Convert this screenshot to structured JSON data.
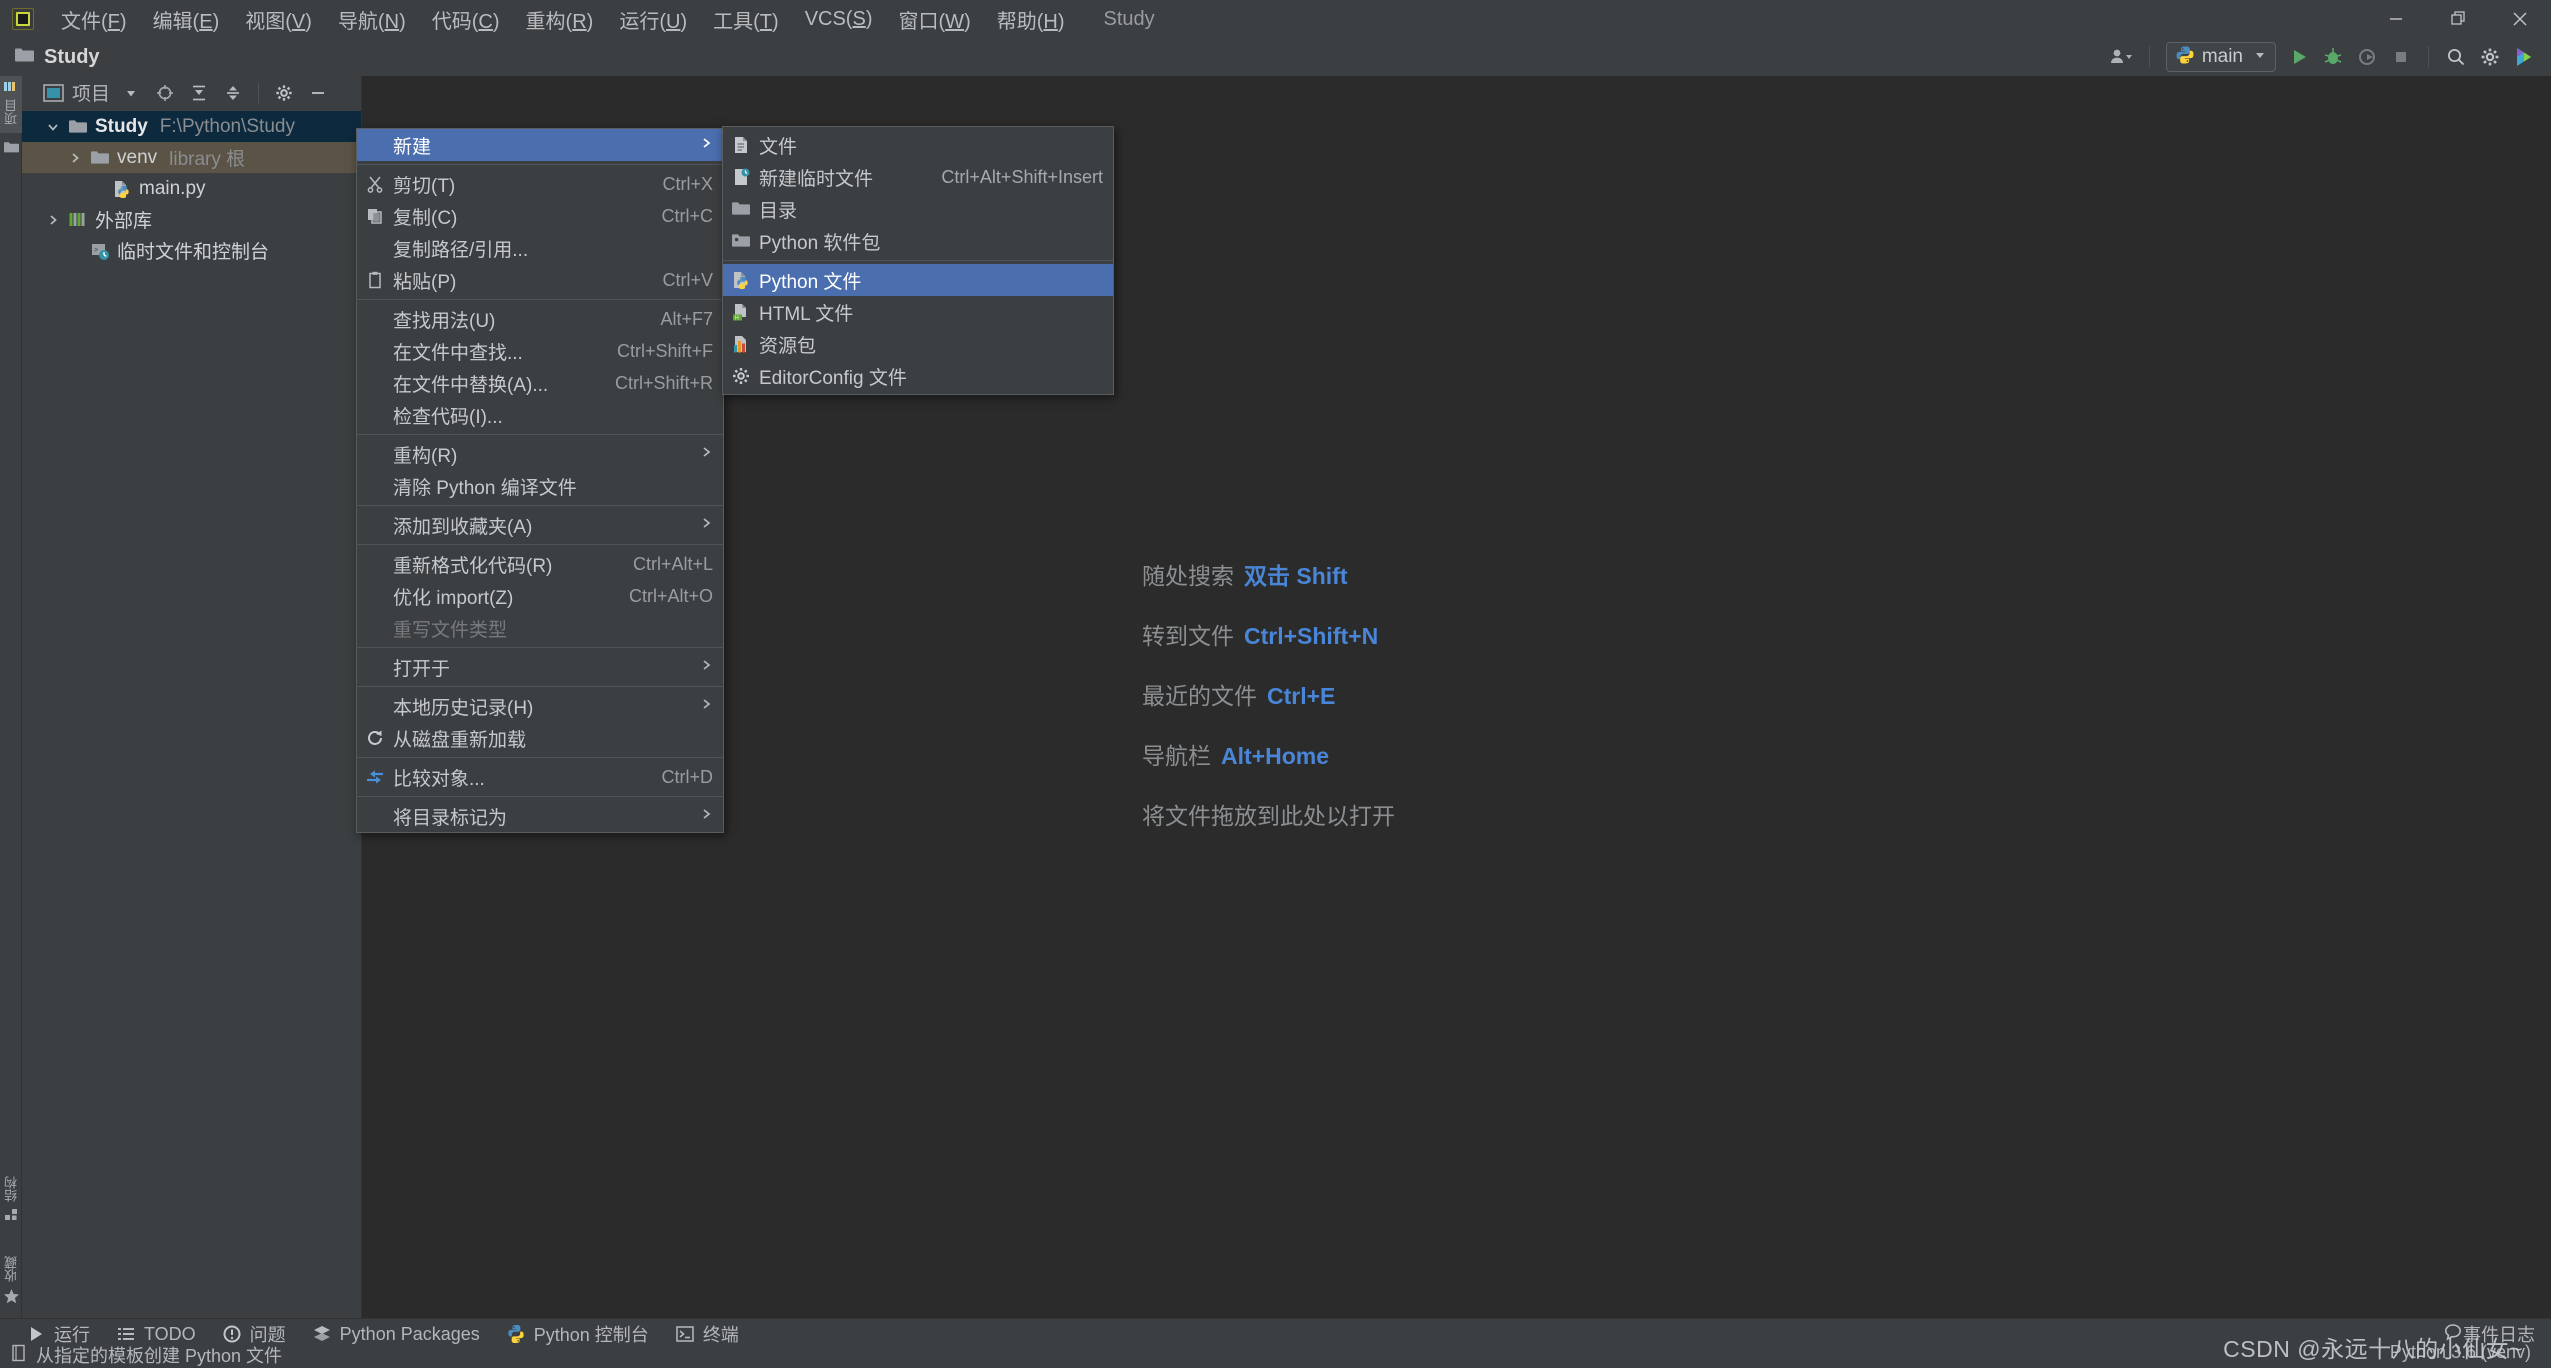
{
  "window": {
    "app_icon": "pycharm-logo-icon",
    "project_name": "Study",
    "menus": [
      {
        "label": "文件(F)",
        "name": "menu-file"
      },
      {
        "label": "编辑(E)",
        "name": "menu-edit"
      },
      {
        "label": "视图(V)",
        "name": "menu-view"
      },
      {
        "label": "导航(N)",
        "name": "menu-navigate"
      },
      {
        "label": "代码(C)",
        "name": "menu-code"
      },
      {
        "label": "重构(R)",
        "name": "menu-refactor"
      },
      {
        "label": "运行(U)",
        "name": "menu-run"
      },
      {
        "label": "工具(T)",
        "name": "menu-tools"
      },
      {
        "label": "VCS(S)",
        "name": "menu-vcs"
      },
      {
        "label": "窗口(W)",
        "name": "menu-window"
      },
      {
        "label": "帮助(H)",
        "name": "menu-help"
      }
    ],
    "controls": {
      "minimize": "–",
      "maximize": "❐",
      "close": "✕"
    }
  },
  "toolbar": {
    "title": "Study",
    "run_config": "main",
    "icons": [
      "account-icon",
      "run-icon",
      "debug-icon",
      "coverage-icon",
      "stop-icon",
      "search-everywhere-icon",
      "settings-icon",
      "ai-assistant-icon"
    ]
  },
  "left_strip": {
    "top_tabs": [
      {
        "label": "项目",
        "name": "vtab-project"
      }
    ],
    "bottom_tabs": [
      {
        "label": "结构",
        "name": "vtab-structure"
      },
      {
        "label": "收藏",
        "name": "vtab-favorites"
      }
    ]
  },
  "project_panel": {
    "title": "项目",
    "toolbar_icons": [
      "project-view-icon",
      "chevron-down-icon",
      "locate-icon",
      "expand-all-icon",
      "collapse-all-icon",
      "settings-icon",
      "hide-icon"
    ],
    "tree": [
      {
        "label": "Study",
        "sublabel": "F:\\Python\\Study",
        "icon": "folder-icon",
        "state": "selected",
        "expander": "▾",
        "depth": 0
      },
      {
        "label": "venv",
        "sublabel": "library 根",
        "icon": "folder-icon",
        "state": "hovered",
        "expander": "›",
        "depth": 1
      },
      {
        "label": "main.py",
        "sublabel": "",
        "icon": "python-file-icon",
        "state": "normal",
        "expander": "",
        "depth": 2
      },
      {
        "label": "外部库",
        "sublabel": "",
        "icon": "external-libraries-icon",
        "state": "normal",
        "expander": "›",
        "depth": 0
      },
      {
        "label": "临时文件和控制台",
        "sublabel": "",
        "icon": "scratches-icon",
        "state": "normal",
        "expander": "",
        "depth": 1
      }
    ]
  },
  "editor_tips": [
    {
      "label": "随处搜索",
      "key": "双击 Shift"
    },
    {
      "label": "转到文件",
      "key": "Ctrl+Shift+N"
    },
    {
      "label": "最近的文件",
      "key": "Ctrl+E"
    },
    {
      "label": "导航栏",
      "key": "Alt+Home"
    },
    {
      "label": "将文件拖放到此处以打开",
      "key": ""
    }
  ],
  "context_menu": {
    "items": [
      {
        "type": "item",
        "label": "新建",
        "shortcut": "",
        "icon": "",
        "arrow": true,
        "state": "selected",
        "name": "ctx-new"
      },
      {
        "type": "sep"
      },
      {
        "type": "item",
        "label": "剪切(T)",
        "shortcut": "Ctrl+X",
        "icon": "cut-icon",
        "arrow": false,
        "state": "normal",
        "name": "ctx-cut"
      },
      {
        "type": "item",
        "label": "复制(C)",
        "shortcut": "Ctrl+C",
        "icon": "copy-icon",
        "arrow": false,
        "state": "normal",
        "name": "ctx-copy"
      },
      {
        "type": "item",
        "label": "复制路径/引用...",
        "shortcut": "",
        "icon": "",
        "arrow": false,
        "state": "normal",
        "name": "ctx-copy-path"
      },
      {
        "type": "item",
        "label": "粘贴(P)",
        "shortcut": "Ctrl+V",
        "icon": "paste-icon",
        "arrow": false,
        "state": "normal",
        "name": "ctx-paste"
      },
      {
        "type": "sep"
      },
      {
        "type": "item",
        "label": "查找用法(U)",
        "shortcut": "Alt+F7",
        "icon": "",
        "arrow": false,
        "state": "normal",
        "name": "ctx-find-usages"
      },
      {
        "type": "item",
        "label": "在文件中查找...",
        "shortcut": "Ctrl+Shift+F",
        "icon": "",
        "arrow": false,
        "state": "normal",
        "name": "ctx-find-in-files"
      },
      {
        "type": "item",
        "label": "在文件中替换(A)...",
        "shortcut": "Ctrl+Shift+R",
        "icon": "",
        "arrow": false,
        "state": "normal",
        "name": "ctx-replace-in-files"
      },
      {
        "type": "item",
        "label": "检查代码(I)...",
        "shortcut": "",
        "icon": "",
        "arrow": false,
        "state": "normal",
        "name": "ctx-inspect-code"
      },
      {
        "type": "sep"
      },
      {
        "type": "item",
        "label": "重构(R)",
        "shortcut": "",
        "icon": "",
        "arrow": true,
        "state": "normal",
        "name": "ctx-refactor"
      },
      {
        "type": "item",
        "label": "清除 Python 编译文件",
        "shortcut": "",
        "icon": "",
        "arrow": false,
        "state": "normal",
        "name": "ctx-clean-pyc"
      },
      {
        "type": "sep"
      },
      {
        "type": "item",
        "label": "添加到收藏夹(A)",
        "shortcut": "",
        "icon": "",
        "arrow": true,
        "state": "normal",
        "name": "ctx-add-to-favorites"
      },
      {
        "type": "sep"
      },
      {
        "type": "item",
        "label": "重新格式化代码(R)",
        "shortcut": "Ctrl+Alt+L",
        "icon": "",
        "arrow": false,
        "state": "normal",
        "name": "ctx-reformat-code"
      },
      {
        "type": "item",
        "label": "优化 import(Z)",
        "shortcut": "Ctrl+Alt+O",
        "icon": "",
        "arrow": false,
        "state": "normal",
        "name": "ctx-optimize-imports"
      },
      {
        "type": "item",
        "label": "重写文件类型",
        "shortcut": "",
        "icon": "",
        "arrow": false,
        "state": "disabled",
        "name": "ctx-override-file-type"
      },
      {
        "type": "sep"
      },
      {
        "type": "item",
        "label": "打开于",
        "shortcut": "",
        "icon": "",
        "arrow": true,
        "state": "normal",
        "name": "ctx-open-in"
      },
      {
        "type": "sep"
      },
      {
        "type": "item",
        "label": "本地历史记录(H)",
        "shortcut": "",
        "icon": "",
        "arrow": true,
        "state": "normal",
        "name": "ctx-local-history"
      },
      {
        "type": "item",
        "label": "从磁盘重新加载",
        "shortcut": "",
        "icon": "reload-icon",
        "arrow": false,
        "state": "normal",
        "name": "ctx-reload-from-disk"
      },
      {
        "type": "sep"
      },
      {
        "type": "item",
        "label": "比较对象...",
        "shortcut": "Ctrl+D",
        "icon": "compare-icon",
        "arrow": false,
        "state": "normal",
        "name": "ctx-compare-with"
      },
      {
        "type": "sep"
      },
      {
        "type": "item",
        "label": "将目录标记为",
        "shortcut": "",
        "icon": "",
        "arrow": true,
        "state": "normal",
        "name": "ctx-mark-directory-as"
      }
    ]
  },
  "submenu": {
    "items": [
      {
        "type": "item",
        "label": "文件",
        "shortcut": "",
        "icon": "file-icon",
        "state": "normal",
        "name": "sub-file"
      },
      {
        "type": "item",
        "label": "新建临时文件",
        "shortcut": "Ctrl+Alt+Shift+Insert",
        "icon": "scratch-file-icon",
        "state": "normal",
        "name": "sub-scratch-file"
      },
      {
        "type": "item",
        "label": "目录",
        "shortcut": "",
        "icon": "folder-icon",
        "state": "normal",
        "name": "sub-directory"
      },
      {
        "type": "item",
        "label": "Python 软件包",
        "shortcut": "",
        "icon": "python-package-icon",
        "state": "normal",
        "name": "sub-python-package"
      },
      {
        "type": "sep"
      },
      {
        "type": "item",
        "label": "Python 文件",
        "shortcut": "",
        "icon": "python-file-icon",
        "state": "selected",
        "name": "sub-python-file"
      },
      {
        "type": "item",
        "label": "HTML 文件",
        "shortcut": "",
        "icon": "html-file-icon",
        "state": "normal",
        "name": "sub-html-file"
      },
      {
        "type": "item",
        "label": "资源包",
        "shortcut": "",
        "icon": "resource-bundle-icon",
        "state": "normal",
        "name": "sub-resource-bundle"
      },
      {
        "type": "item",
        "label": "EditorConfig 文件",
        "shortcut": "",
        "icon": "gear-icon",
        "state": "normal",
        "name": "sub-editorconfig-file"
      }
    ]
  },
  "bottom_bar": {
    "items": [
      {
        "label": "运行",
        "icon": "run-icon",
        "name": "tool-run"
      },
      {
        "label": "TODO",
        "icon": "todo-icon",
        "name": "tool-todo"
      },
      {
        "label": "问题",
        "icon": "problems-icon",
        "name": "tool-problems"
      },
      {
        "label": "Python Packages",
        "icon": "packages-icon",
        "name": "tool-python-packages"
      },
      {
        "label": "Python 控制台",
        "icon": "python-icon",
        "name": "tool-python-console"
      },
      {
        "label": "终端",
        "icon": "terminal-icon",
        "name": "tool-terminal"
      }
    ],
    "right": {
      "label": "事件日志",
      "icon": "event-log-icon",
      "name": "tool-event-log"
    }
  },
  "status_bar": {
    "message": "从指定的模板创建 Python 文件",
    "message_icon": "template-icon",
    "interpreter": "Python 3.6 (venv)"
  },
  "watermark": "CSDN @永远十八的小仙女~",
  "colors": {
    "chrome": "#3c3f41",
    "editor_bg": "#2b2b2b",
    "selection_blue": "#4b6eaf",
    "tree_selected": "#0d293e",
    "tree_hovered": "#5b5345",
    "accent_link": "#4a86d8",
    "text": "#bbbbbb"
  }
}
